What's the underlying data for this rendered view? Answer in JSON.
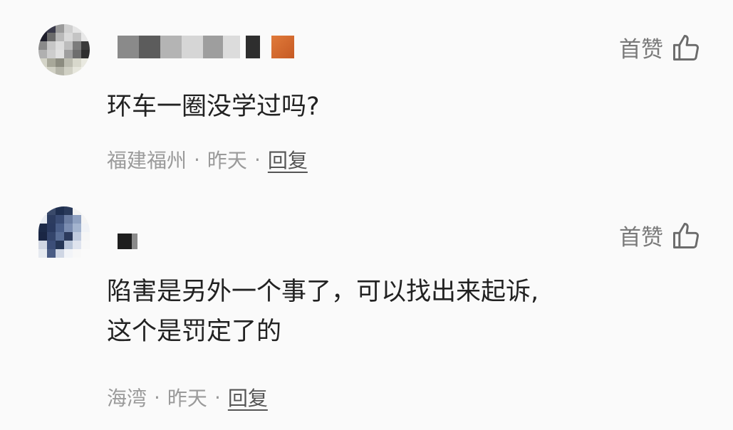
{
  "comments": [
    {
      "text_lines": [
        "环车一圈没学过吗?"
      ],
      "location": "福建福州",
      "time": "昨天",
      "reply_label": "回复",
      "like_label": "首赞",
      "like_icon": "thumbs-up-icon"
    },
    {
      "text_lines": [
        "陷害是另外一个事了，可以找出来起诉,",
        "这个是罚定了的"
      ],
      "location": "海湾",
      "time": "昨天",
      "reply_label": "回复",
      "like_label": "首赞",
      "like_icon": "thumbs-up-icon"
    }
  ],
  "separator": "·",
  "colors": {
    "background": "#fafafa",
    "text": "#222222",
    "meta": "#9a9a9a",
    "like": "#7a7a7a"
  }
}
